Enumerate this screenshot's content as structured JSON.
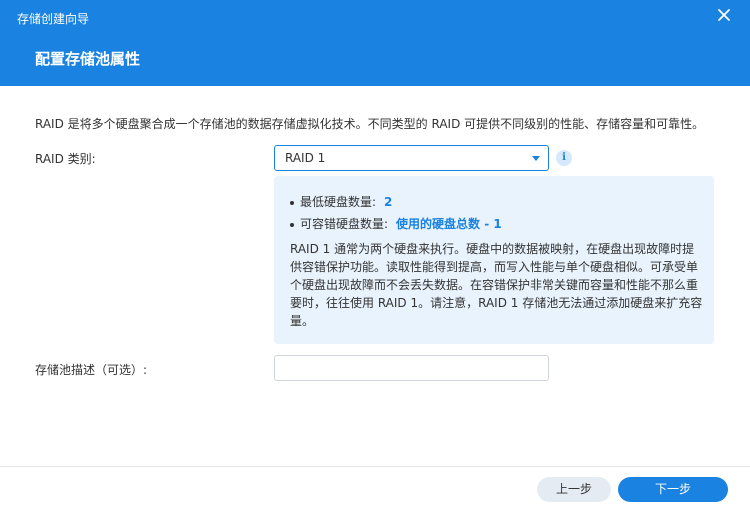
{
  "window": {
    "title": "存储创建向导"
  },
  "page": {
    "title": "配置存储池属性",
    "intro": "RAID 是将多个硬盘聚合成一个存储池的数据存储虚拟化技术。不同类型的 RAID 可提供不同级别的性能、存储容量和可靠性。"
  },
  "raid": {
    "label": "RAID 类别:",
    "selected": "RAID 1",
    "info_glyph": "i"
  },
  "info_panel": {
    "min_disks_label": "最低硬盘数量:",
    "min_disks_value": "2",
    "fault_tolerance_label": "可容错硬盘数量:",
    "fault_tolerance_value": "使用的硬盘总数 - 1",
    "description": "RAID 1 通常为两个硬盘来执行。硬盘中的数据被映射，在硬盘出现故障时提供容错保护功能。读取性能得到提高，而写入性能与单个硬盘相似。可承受单个硬盘出现故障而不会丢失数据。在容错保护非常关键而容量和性能不那么重要时，往往使用 RAID 1。请注意，RAID 1 存储池无法通过添加硬盘来扩充容量。"
  },
  "description_field": {
    "label": "存储池描述（可选）:",
    "value": "",
    "placeholder": ""
  },
  "footer": {
    "prev_label": "上一步",
    "next_label": "下一步"
  },
  "colors": {
    "accent": "#1a82e0",
    "info_panel_bg": "#e9f3fd",
    "secondary_button_bg": "#e4ebf2"
  },
  "icons": {
    "close": "close-icon",
    "dropdown": "chevron-down-icon",
    "info": "info-icon"
  }
}
